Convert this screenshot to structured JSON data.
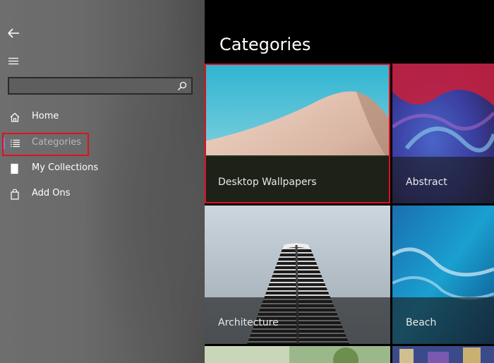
{
  "sidebar": {
    "search": {
      "placeholder": "",
      "value": ""
    },
    "items": [
      {
        "label": "Home",
        "icon": "home-icon"
      },
      {
        "label": "Categories",
        "icon": "list-icon",
        "active": true
      },
      {
        "label": "My Collections",
        "icon": "collections-icon"
      },
      {
        "label": "Add Ons",
        "icon": "shopping-bag-icon"
      }
    ]
  },
  "main": {
    "title": "Categories",
    "tiles": [
      {
        "label": "Desktop Wallpapers",
        "highlighted": true
      },
      {
        "label": "Abstract"
      },
      {
        "label": "Architecture"
      },
      {
        "label": "Beach"
      }
    ]
  },
  "colors": {
    "highlight": "#e0101f",
    "active_indicator": "#8a7bd8"
  }
}
